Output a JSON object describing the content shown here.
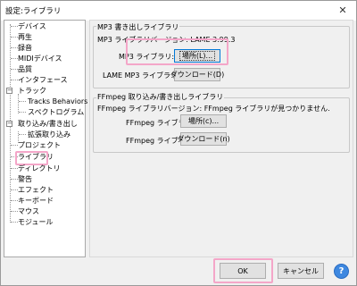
{
  "window": {
    "title": "設定:ライブラリ",
    "close_label": "✕"
  },
  "sidebar": {
    "items": [
      {
        "label": "デバイス"
      },
      {
        "label": "再生"
      },
      {
        "label": "録音"
      },
      {
        "label": "MIDIデバイス"
      },
      {
        "label": "品質"
      },
      {
        "label": "インタフェース"
      },
      {
        "label": "トラック",
        "toggle": "−"
      },
      {
        "label": "Tracks Behaviors"
      },
      {
        "label": "スペクトログラム"
      },
      {
        "label": "取り込み/書き出し",
        "toggle": "−"
      },
      {
        "label": "拡張取り込み"
      },
      {
        "label": "プロジェクト"
      },
      {
        "label": "ライブラリ"
      },
      {
        "label": "ディレクトリ"
      },
      {
        "label": "警告"
      },
      {
        "label": "エフェクト"
      },
      {
        "label": "キーボード"
      },
      {
        "label": "マウス"
      },
      {
        "label": "モジュール"
      }
    ]
  },
  "mp3": {
    "group_title": "MP3 書き出しライブラリ",
    "version_label": "MP3 ライブラリバージョン: LAME 3.99.3",
    "library_label": "MP3 ライブラリ:",
    "locate_button": "場所(L)...",
    "lame_label": "LAME MP3 ライブラリ:",
    "download_button": "ダウンロード(D)"
  },
  "ffmpeg": {
    "group_title": "FFmpeg 取り込み/書き出しライブラリ",
    "version_text": "FFmpeg ライブラリバージョン: FFmpeg ライブラリが見つかりません.",
    "library_label": "FFmpeg ライブラリ:",
    "locate_button": "場所(c)...",
    "library_label_2": "FFmpeg ライブラリ:",
    "download_button": "ダウンロード(n)"
  },
  "footer": {
    "ok_button": "OK",
    "cancel_button": "キャンセル",
    "help_button": "?"
  },
  "colors": {
    "highlight": "#f4a6c8",
    "help_blue": "#3e88e0"
  }
}
